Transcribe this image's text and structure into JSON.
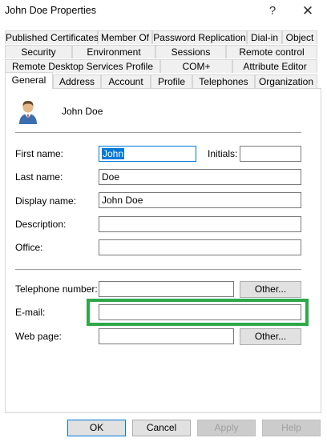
{
  "window": {
    "title": "John Doe Properties",
    "help_glyph": "?",
    "close_glyph": "✕"
  },
  "tabs": {
    "row1": [
      "Published Certificates",
      "Member Of",
      "Password Replication",
      "Dial-in",
      "Object"
    ],
    "row2": [
      "Security",
      "Environment",
      "Sessions",
      "Remote control"
    ],
    "row3": [
      "Remote Desktop Services Profile",
      "COM+",
      "Attribute Editor"
    ],
    "row4": [
      "General",
      "Address",
      "Account",
      "Profile",
      "Telephones",
      "Organization"
    ],
    "active": "General"
  },
  "general": {
    "user_display": "John Doe",
    "avatar_icon": "user-icon",
    "fields": {
      "first_name": {
        "label": "First name:",
        "value": "John"
      },
      "initials": {
        "label": "Initials:",
        "value": ""
      },
      "last_name": {
        "label": "Last name:",
        "value": "Doe"
      },
      "display_name": {
        "label": "Display name:",
        "value": "John Doe"
      },
      "description": {
        "label": "Description:",
        "value": ""
      },
      "office": {
        "label": "Office:",
        "value": ""
      },
      "telephone": {
        "label": "Telephone number:",
        "value": ""
      },
      "email": {
        "label": "E-mail:",
        "value": ""
      },
      "web_page": {
        "label": "Web page:",
        "value": ""
      }
    },
    "other_label": "Other...",
    "highlight_color": "#2ea84a"
  },
  "buttons": {
    "ok": "OK",
    "cancel": "Cancel",
    "apply": "Apply",
    "help": "Help"
  }
}
